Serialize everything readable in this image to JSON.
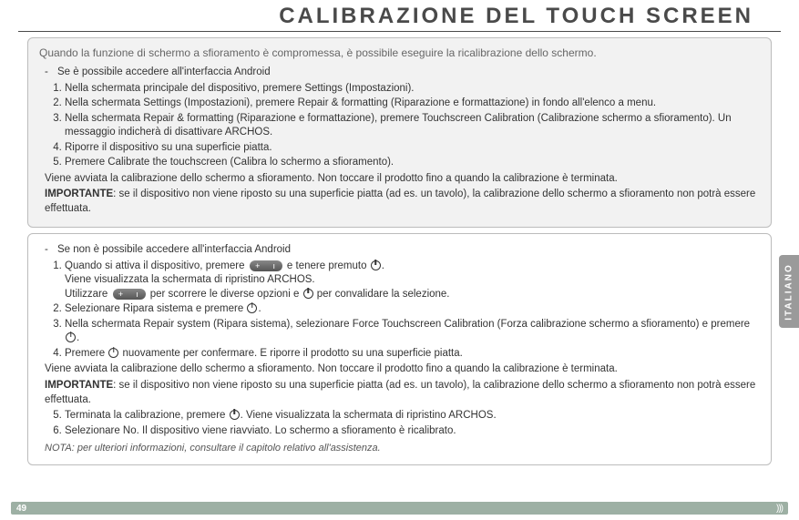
{
  "title": "CALIBRAZIONE DEL TOUCH SCREEN",
  "block1": {
    "intro": "Quando la funzione di schermo a sfioramento è compromessa, è possibile eseguire la ricalibrazione dello schermo.",
    "dash": "Se è possibile accedere all'interfaccia Android",
    "steps": [
      "Nella schermata principale del dispositivo, premere Settings (Impostazioni).",
      "Nella schermata Settings (Impostazioni), premere Repair & formatting (Riparazione e formattazione) in fondo all'elenco a menu.",
      "Nella schermata Repair & formatting (Riparazione e formattazione), premere Touchscreen Calibration (Calibrazione schermo a sfioramento). Un messaggio indicherà di disattivare ARCHOS.",
      "Riporre il dispositivo su una superficie piatta.",
      "Premere Calibrate the touchscreen (Calibra lo schermo a sfioramento)."
    ],
    "after": "Viene avviata la calibrazione dello schermo a sfioramento. Non toccare il prodotto fino a quando la calibrazione è terminata.",
    "important_label": "IMPORTANTE",
    "important_text": ": se il dispositivo non viene riposto su una superficie piatta (ad es. un tavolo), la calibrazione dello schermo a sfioramento non potrà essere effettuata."
  },
  "block2": {
    "dash": "Se non è possibile accedere all'interfaccia Android",
    "step1a": "Quando si attiva il dispositivo, premere",
    "step1b": "e tenere premuto",
    "step1c": ".",
    "step1d": "Viene visualizzata la schermata di ripristino ARCHOS.",
    "step1e": "Utilizzare",
    "step1f": "per scorrere le diverse opzioni e",
    "step1g": "per convalidare la selezione.",
    "step2a": "Selezionare Ripara sistema e premere",
    "step2b": ".",
    "step3a": "Nella schermata Repair system (Ripara sistema), selezionare Force Touchscreen Calibration (Forza calibrazione schermo a sfioramento) e premere",
    "step3b": ".",
    "step4a": "Premere",
    "step4b": "nuovamente per confermare. E riporre il prodotto su una superficie piatta.",
    "after": "Viene avviata la calibrazione dello schermo a sfioramento. Non toccare il prodotto fino a quando la calibrazione è terminata.",
    "important_label": "IMPORTANTE",
    "important_text": ": se il dispositivo non viene riposto su una superficie piatta (ad es. un tavolo), la calibrazione dello schermo a sfioramento non potrà essere effettuata.",
    "step5a": "Terminata la calibrazione, premere",
    "step5b": ". Viene visualizzata la schermata di ripristino ARCHOS.",
    "step6": "Selezionare No. Il dispositivo viene riavviato. Lo schermo a sfioramento è ricalibrato.",
    "note": "NOTA: per ulteriori informazioni, consultare il capitolo relativo all'assistenza."
  },
  "sidetab": "ITALIANO",
  "pagenum": "49",
  "deco": ")))"
}
